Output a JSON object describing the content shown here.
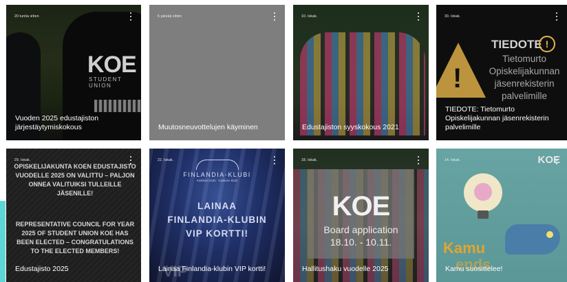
{
  "cards": [
    {
      "date": "20 tuntia sitten",
      "caption": "Vuoden 2025 edustajiston järjestäytymiskokous",
      "image": {
        "logo_text": "KOE",
        "logo_sub": "STUDENT UNION"
      }
    },
    {
      "date": "6 päivää sitten",
      "caption": "Muutosneuvottelujen käyminen"
    },
    {
      "date": "10. lokak.",
      "caption": "Edustajiston syyskokous 2021"
    },
    {
      "date": "30. lokak.",
      "caption": "TIEDOTE: Tietomurto Opiskelijakunnan jäsenrekisterin palvelimille",
      "image": {
        "title": "TIEDOTE",
        "mark": "!",
        "body": "Tietomurto Opiskelijakunnan jäsenrekisterin palvelimille"
      }
    },
    {
      "date": "29. lokak.",
      "caption": "Edustajisto 2025",
      "image": {
        "finnish_text": "OPISKELIJAKUNTA KOEN EDUSTAJISTO VUODELLE 2025 ON VALITTU – PALJON ONNEA VALITUIKSI TULLEILLE JÄSENILLE!",
        "english_text": "REPRESENTATIVE COUNCIL FOR YEAR 2025 OF STUDENT UNION KOE HAS BEEN ELECTED – CONGRATULATIONS TO THE ELECTED MEMBERS!"
      }
    },
    {
      "date": "22. lokak.",
      "caption": "Lainaa Finlandia-klubin VIP kortti!",
      "image": {
        "club_name": "FINLANDIA-KLUBI",
        "club_sub": "Kaikkien klubi · Kaikkien klubi",
        "headline_1": "LAINAA",
        "headline_2": "FINLANDIA-KLUBIN",
        "headline_3": "VIP KORTTI!",
        "ghost": "VIP"
      }
    },
    {
      "date": "18. lokak.",
      "caption": "Hallitushaku vuodelle 2025",
      "image": {
        "logo_text": "KOE",
        "line_1": "Board application",
        "line_2": "18.10. - 10.11."
      }
    },
    {
      "date": "14. lokak.",
      "caption": "Kamu suosittelee!",
      "image": {
        "logo_text": "KOE",
        "word_1": "Kamu",
        "word_2": "ends"
      }
    }
  ],
  "icons": {
    "card_menu": "more-vertical-icon"
  },
  "colors": {
    "accent_teal": "#5fd6d6",
    "warning_yellow": "#e8b64a",
    "kamu_orange": "#e3a52f"
  }
}
